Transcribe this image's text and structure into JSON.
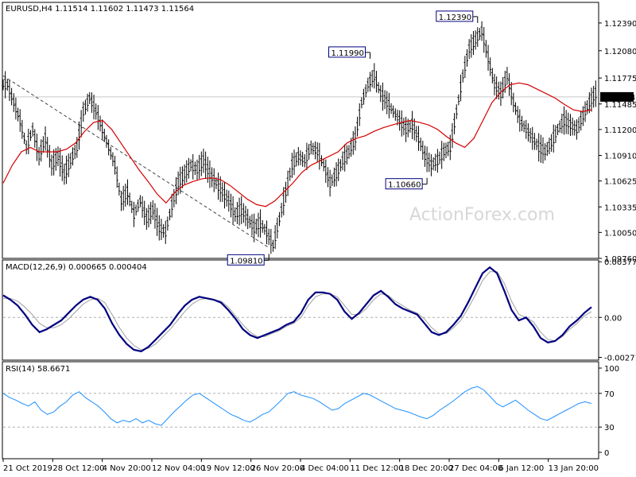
{
  "chart_data": {
    "type": "candlestick-with-indicators",
    "symbol_header": "EURUSD,H4  1.11514 1.11602 1.11473 1.11564",
    "watermark": "ActionForex.com",
    "price_panel": {
      "ylim": [
        1.0976,
        1.1262
      ],
      "y_ticks": [
        "1.12390",
        "1.12080",
        "1.11775",
        "1.11485",
        "1.11200",
        "1.10910",
        "1.10625",
        "1.10335",
        "1.10050",
        "1.09760"
      ],
      "current_price_label": "1.11564",
      "current_price": 1.11564,
      "annotations": [
        {
          "text": "1.09810",
          "x_index": 42,
          "value": 1.0981
        },
        {
          "text": "1.11990",
          "x_index": 58,
          "value": 1.1199
        },
        {
          "text": "1.10660",
          "x_index": 67,
          "value": 1.1066
        },
        {
          "text": "1.12390",
          "x_index": 75,
          "value": 1.1239
        }
      ],
      "trendline": {
        "from": {
          "x_index": 0,
          "value": 1.118
        },
        "to": {
          "x_index": 42,
          "value": 1.0988
        }
      },
      "series_close": [
        1.117,
        1.115,
        1.113,
        1.11,
        1.112,
        1.109,
        1.111,
        1.108,
        1.109,
        1.107,
        1.1085,
        1.11,
        1.114,
        1.1155,
        1.114,
        1.112,
        1.11,
        1.108,
        1.104,
        1.105,
        1.1025,
        1.104,
        1.102,
        1.103,
        1.101,
        1.1005,
        1.1035,
        1.106,
        1.107,
        1.108,
        1.1075,
        1.1085,
        1.107,
        1.106,
        1.105,
        1.104,
        1.1025,
        1.103,
        1.102,
        1.101,
        1.1015,
        1.1005,
        1.099,
        1.102,
        1.105,
        1.108,
        1.109,
        1.1085,
        1.11,
        1.1095,
        1.108,
        1.106,
        1.107,
        1.1085,
        1.1095,
        1.111,
        1.115,
        1.117,
        1.118,
        1.116,
        1.115,
        1.114,
        1.113,
        1.112,
        1.1125,
        1.111,
        1.109,
        1.108,
        1.1085,
        1.1095,
        1.11,
        1.114,
        1.118,
        1.121,
        1.122,
        1.123,
        1.12,
        1.117,
        1.116,
        1.118,
        1.115,
        1.113,
        1.112,
        1.111,
        1.11,
        1.1095,
        1.1105,
        1.112,
        1.113,
        1.1125,
        1.112,
        1.1135,
        1.115,
        1.116
      ],
      "ma_series": [
        1.106,
        1.108,
        1.1095,
        1.11,
        1.1095,
        1.1095,
        1.1095,
        1.1098,
        1.1105,
        1.1118,
        1.1128,
        1.113,
        1.112,
        1.1105,
        1.109,
        1.1075,
        1.1062,
        1.1048,
        1.1038,
        1.105,
        1.1058,
        1.1062,
        1.1065,
        1.1066,
        1.1064,
        1.1058,
        1.105,
        1.1042,
        1.1036,
        1.1034,
        1.104,
        1.105,
        1.106,
        1.1072,
        1.108,
        1.1085,
        1.109,
        1.1095,
        1.1105,
        1.111,
        1.1113,
        1.1118,
        1.1122,
        1.1125,
        1.1128,
        1.113,
        1.1128,
        1.1125,
        1.112,
        1.1112,
        1.1105,
        1.11,
        1.111,
        1.113,
        1.115,
        1.1162,
        1.117,
        1.1172,
        1.117,
        1.1165,
        1.116,
        1.1155,
        1.1148,
        1.1142,
        1.114,
        1.1142
      ]
    },
    "macd_panel": {
      "label": "MACD(12,26,9) 0.000665 0.000404",
      "ylim": [
        -0.0029,
        0.0039
      ],
      "y_ticks": [
        "0.003779",
        "0.00",
        "-0.002711"
      ],
      "macd": [
        0.0015,
        0.0012,
        0.0008,
        0.0002,
        -0.0005,
        -0.001,
        -0.0008,
        -0.0005,
        -0.0002,
        0.0003,
        0.0008,
        0.0012,
        0.0014,
        0.0012,
        0.0006,
        -0.0004,
        -0.0012,
        -0.0018,
        -0.0022,
        -0.0023,
        -0.002,
        -0.0015,
        -0.001,
        -0.0005,
        0.0002,
        0.0008,
        0.0012,
        0.0014,
        0.0013,
        0.0012,
        0.001,
        0.0005,
        -0.0001,
        -0.0008,
        -0.0012,
        -0.0014,
        -0.0012,
        -0.001,
        -0.0008,
        -0.0005,
        -0.0003,
        0.0003,
        0.0012,
        0.0017,
        0.0017,
        0.0016,
        0.0012,
        0.0004,
        -0.0001,
        0.0003,
        0.0009,
        0.0015,
        0.0018,
        0.0014,
        0.0009,
        0.0006,
        0.0004,
        0.0002,
        -0.0004,
        -0.001,
        -0.0012,
        -0.001,
        -0.0005,
        0.0001,
        0.001,
        0.002,
        0.003,
        0.0034,
        0.003,
        0.0018,
        0.0005,
        -0.0002,
        0.0,
        -0.0006,
        -0.0014,
        -0.0017,
        -0.0016,
        -0.0012,
        -0.0006,
        -0.0002,
        0.0003,
        0.0007
      ],
      "signal": [
        0.0013,
        0.0013,
        0.0011,
        0.0007,
        0.0002,
        -0.0004,
        -0.0007,
        -0.0007,
        -0.0005,
        -0.0001,
        0.0004,
        0.0009,
        0.0012,
        0.0013,
        0.001,
        0.0002,
        -0.0007,
        -0.0014,
        -0.0019,
        -0.0022,
        -0.0021,
        -0.0018,
        -0.0013,
        -0.0008,
        -0.0002,
        0.0004,
        0.0009,
        0.0012,
        0.0013,
        0.0012,
        0.0011,
        0.0007,
        0.0001,
        -0.0005,
        -0.001,
        -0.0013,
        -0.0013,
        -0.0011,
        -0.0009,
        -0.0006,
        -0.0004,
        0.0,
        0.0008,
        0.0014,
        0.0016,
        0.0016,
        0.0014,
        0.0008,
        0.0002,
        0.0002,
        0.0006,
        0.0012,
        0.0016,
        0.0015,
        0.0011,
        0.0008,
        0.0005,
        0.0003,
        -0.0001,
        -0.0007,
        -0.0011,
        -0.0011,
        -0.0007,
        -0.0002,
        0.0006,
        0.0015,
        0.0025,
        0.0031,
        0.0031,
        0.0023,
        0.0011,
        0.0002,
        0.0,
        -0.0003,
        -0.001,
        -0.0015,
        -0.0016,
        -0.0013,
        -0.0008,
        -0.0004,
        0.0001,
        0.0004
      ]
    },
    "rsi_panel": {
      "label": "RSI(14) 58.6671",
      "ylim": [
        0,
        100
      ],
      "y_ticks": [
        "100",
        "70",
        "30",
        "0"
      ],
      "levels": [
        70,
        30
      ],
      "values": [
        70,
        65,
        62,
        58,
        55,
        60,
        50,
        45,
        48,
        55,
        60,
        68,
        72,
        65,
        60,
        55,
        48,
        40,
        35,
        38,
        36,
        40,
        35,
        38,
        34,
        32,
        40,
        48,
        55,
        62,
        68,
        70,
        65,
        60,
        55,
        50,
        45,
        42,
        38,
        36,
        40,
        45,
        48,
        55,
        62,
        70,
        72,
        68,
        66,
        64,
        60,
        55,
        50,
        52,
        58,
        62,
        66,
        70,
        68,
        64,
        60,
        56,
        52,
        50,
        48,
        45,
        42,
        40,
        44,
        50,
        55,
        60,
        66,
        72,
        76,
        78,
        74,
        66,
        58,
        54,
        58,
        62,
        56,
        50,
        45,
        40,
        38,
        42,
        46,
        50,
        54,
        58,
        60,
        58
      ]
    },
    "x_tick_labels": [
      "21 Oct 2019",
      "28 Oct 12:00",
      "4 Nov 20:00",
      "12 Nov 04:00",
      "19 Nov 12:00",
      "26 Nov 20:00",
      "4 Dec 04:00",
      "11 Dec 12:00",
      "18 Dec 20:00",
      "27 Dec 04:00",
      "6 Jan 12:00",
      "13 Jan 20:00"
    ],
    "colors": {
      "candles": "#000000",
      "ma": "#d40000",
      "macd": "#000080",
      "signal": "#a0a0a0",
      "rsi": "#1e90ff",
      "level_line": "#b0b0b0",
      "annotation_text": "#000080"
    }
  }
}
